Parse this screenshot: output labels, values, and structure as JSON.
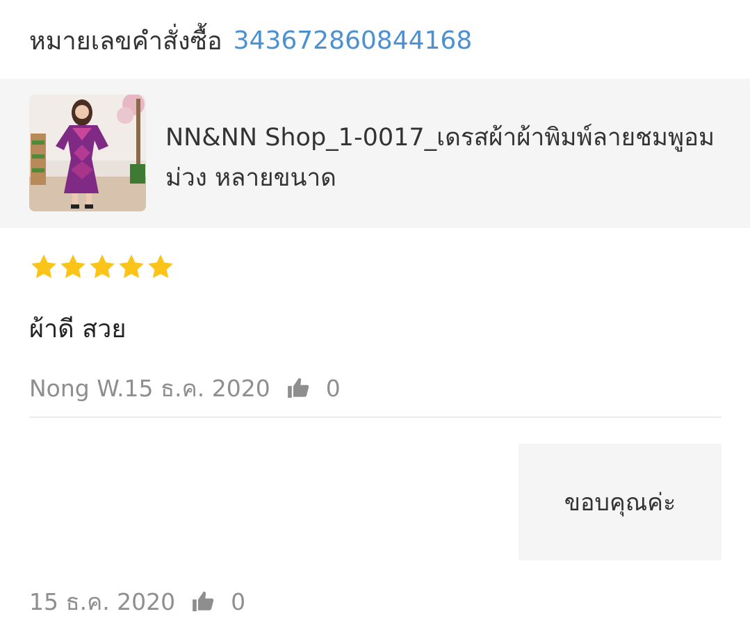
{
  "order": {
    "label": "หมายเลขคำสั่งซื้อ",
    "number": "343672860844168"
  },
  "product": {
    "name": "NN&NN Shop_1-0017_เดรสผ้าผ้าพิมพ์ลายชมพูอมม่วง หลายขนาด",
    "image_icon": "dress-photo"
  },
  "review": {
    "rating": 5,
    "max_rating": 5,
    "star_color": "#fcc419",
    "text": "ผ้าดี สวย",
    "author_date": "Nong W.15 ธ.ค. 2020",
    "likes": "0"
  },
  "reply": {
    "text": "ขอบคุณค่ะ",
    "date": "15 ธ.ค. 2020",
    "likes": "0"
  },
  "colors": {
    "link": "#4a90d2",
    "muted": "#8e8e8e",
    "panel": "#f5f5f5"
  }
}
